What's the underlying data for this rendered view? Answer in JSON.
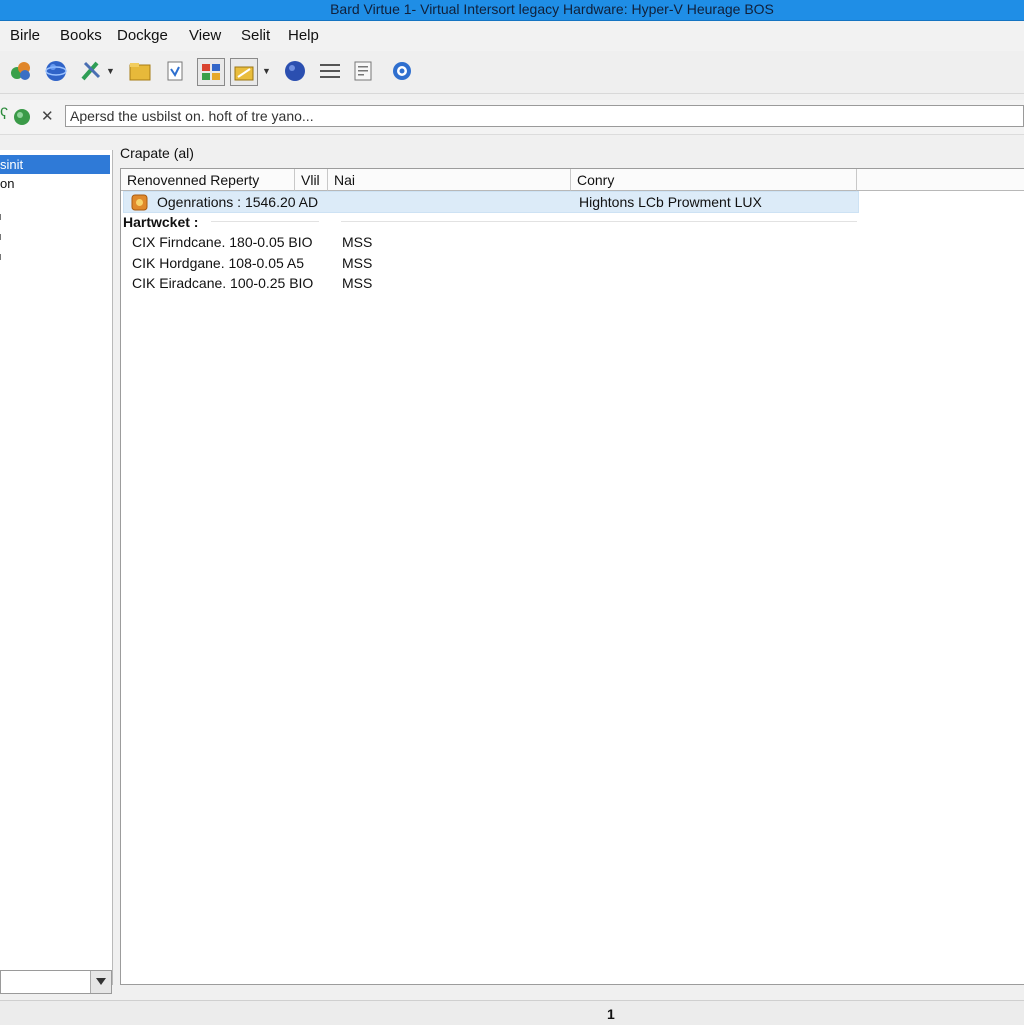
{
  "window": {
    "title": "Bard Virtue 1- Virtual Intersort legacy Hardware: Hyper-V Heurage BOS"
  },
  "menu": [
    "Birle",
    "Books",
    "Dockge",
    "View",
    "Selit",
    "Help"
  ],
  "address": {
    "value": "Apersd the usbilst on. hoft of tre yano..."
  },
  "tree": {
    "items": [
      "sinit",
      "on"
    ]
  },
  "content": {
    "section_title": "Crapate (al)",
    "columns": [
      "Renovenned Reperty",
      "Vlil",
      "Nai",
      "Conry"
    ],
    "selected_row": {
      "name": "Ogenrations : 1546.20 AD",
      "conry": "Hightons LCb Prowment LUX"
    },
    "group_label": "Hartwcket :",
    "rows": [
      {
        "name": "CIX Firndcane. 180-0.05 BIO",
        "nai": "MSS"
      },
      {
        "name": "CIK Hordgane. 108-0.05 A5",
        "nai": "MSS"
      },
      {
        "name": "CIK Eiradcane. 100-0.25 BIO",
        "nai": "MSS"
      }
    ]
  },
  "status": {
    "page": "1"
  },
  "colors": {
    "titlebar": "#1f8ee6",
    "selection": "#2f7ad7",
    "row_highlight": "#dcebf8"
  }
}
